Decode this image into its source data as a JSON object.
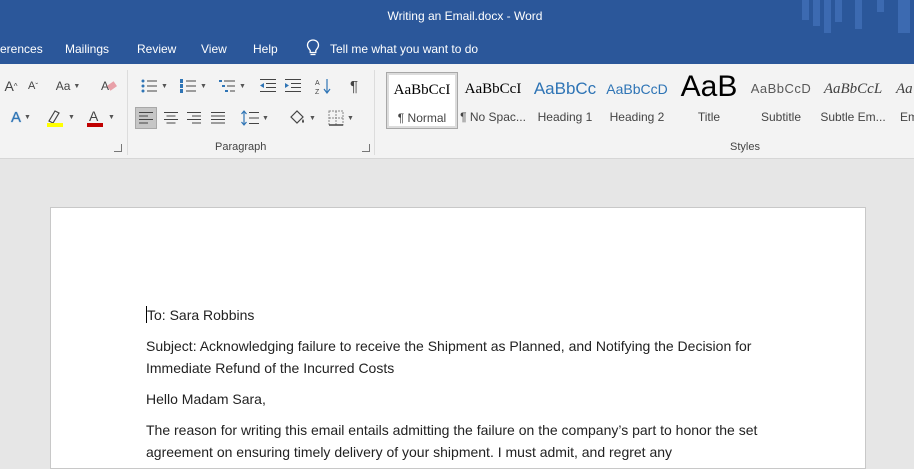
{
  "window": {
    "title": "Writing an Email.docx  -  Word"
  },
  "menu": {
    "items": [
      "erences",
      "Mailings",
      "Review",
      "View",
      "Help"
    ],
    "tell_me": "Tell me what you want to do"
  },
  "ribbon": {
    "font_group": {
      "change_case": "Aa"
    },
    "paragraph_group": {
      "label": "Paragraph"
    },
    "styles_group": {
      "label": "Styles",
      "styles": [
        {
          "preview": "AaBbCcI",
          "name": "¶ Normal",
          "color": "#000000"
        },
        {
          "preview": "AaBbCcI",
          "name": "¶ No Spac...",
          "color": "#000000"
        },
        {
          "preview": "AaBbCc",
          "name": "Heading 1",
          "color": "#2e74b5"
        },
        {
          "preview": "AaBbCcD",
          "name": "Heading 2",
          "color": "#2e74b5"
        },
        {
          "preview": "AaB",
          "name": "Title",
          "color": "#000000"
        },
        {
          "preview": "AaBbCcD",
          "name": "Subtitle",
          "color": "#595959"
        },
        {
          "preview": "AaBbCcL",
          "name": "Subtle Em...",
          "color": "#404040"
        },
        {
          "preview": "Aa",
          "name": "Em",
          "color": "#404040"
        }
      ]
    }
  },
  "document": {
    "paragraphs": [
      "To: Sara Robbins",
      "Subject: Acknowledging failure to receive the Shipment as Planned, and Notifying the Decision for Immediate Refund of the Incurred Costs",
      "Hello Madam Sara,",
      "The reason for writing this email entails admitting the failure on the company’s part to honor the set agreement on ensuring timely delivery of your shipment. I must admit, and regret any"
    ]
  },
  "colors": {
    "accent": "#2b579a",
    "highlight": "#ffff00",
    "font_color": "#c00000"
  }
}
